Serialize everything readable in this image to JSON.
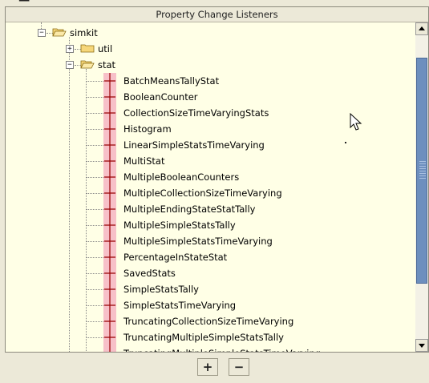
{
  "panel": {
    "title": "Property Change Listeners"
  },
  "tree": {
    "root": {
      "label": "simkit",
      "expanded": true,
      "toggle": "−"
    },
    "util": {
      "label": "util",
      "expanded": false,
      "toggle": "+"
    },
    "stat": {
      "label": "stat",
      "expanded": true,
      "toggle": "−",
      "children": [
        "BatchMeansTallyStat",
        "BooleanCounter",
        "CollectionSizeTimeVaryingStats",
        "Histogram",
        "LinearSimpleStatsTimeVarying",
        "MultiStat",
        "MultipleBooleanCounters",
        "MultipleCollectionSizeTimeVarying",
        "MultipleEndingStateStatTally",
        "MultipleSimpleStatsTally",
        "MultipleSimpleStatsTimeVarying",
        "PercentageInStateStat",
        "SavedStats",
        "SimpleStatsTally",
        "SimpleStatsTimeVarying",
        "TruncatingCollectionSizeTimeVarying",
        "TruncatingMultipleSimpleStatsTally",
        "TruncatingMultipleSimpleStatsTimeVarying"
      ]
    }
  },
  "buttons": {
    "add_label": "+",
    "remove_label": "−"
  },
  "icons": {
    "folder": "folder-icon",
    "leaf": "property-listener-icon",
    "scroll_up": "arrow-up-icon",
    "scroll_down": "arrow-down-icon"
  },
  "colors": {
    "tree_background": "#ffffe6",
    "leaf_icon_fill": "#f7c0c8",
    "leaf_icon_stroke": "#990000",
    "scroll_thumb": "#6d8fbe"
  }
}
